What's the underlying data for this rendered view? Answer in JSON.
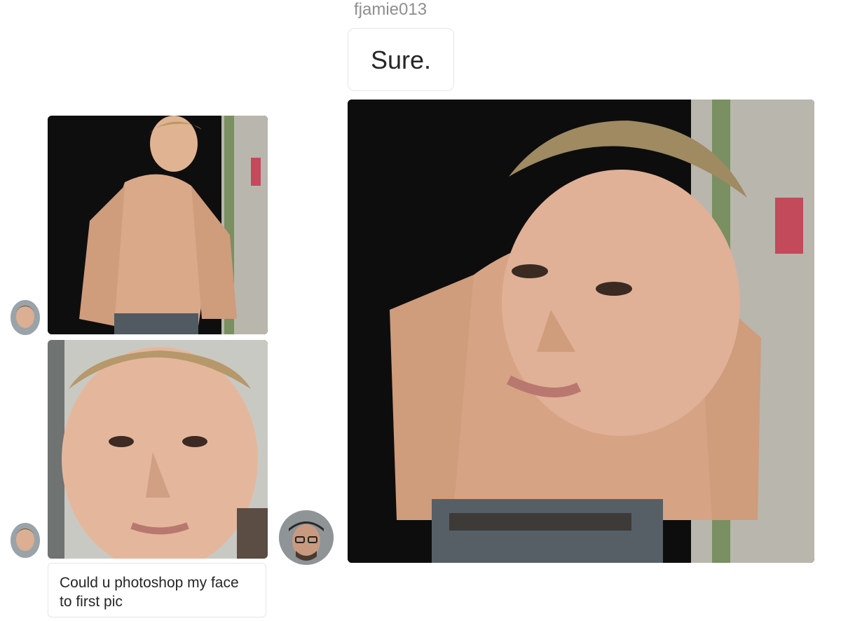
{
  "conversation": {
    "incoming": {
      "photos": [
        {
          "kind": "image",
          "description_icon": "shirtless-photo-icon"
        },
        {
          "kind": "image",
          "description_icon": "selfie-photo-icon"
        }
      ],
      "text_message": "Could u photoshop my face to first pic"
    },
    "outgoing": {
      "sender_name": "fjamie013",
      "text_message": "Sure.",
      "photo": {
        "kind": "image",
        "description_icon": "edited-photo-icon"
      }
    }
  },
  "colors": {
    "bubble_border": "#e3e5e8",
    "text_primary": "#262626",
    "text_secondary": "#8e8e8e",
    "photo_dark": "#111111",
    "skin": "#d9a98a",
    "wall_green": "#7a8f62",
    "wall_grey": "#b9b6ae"
  }
}
